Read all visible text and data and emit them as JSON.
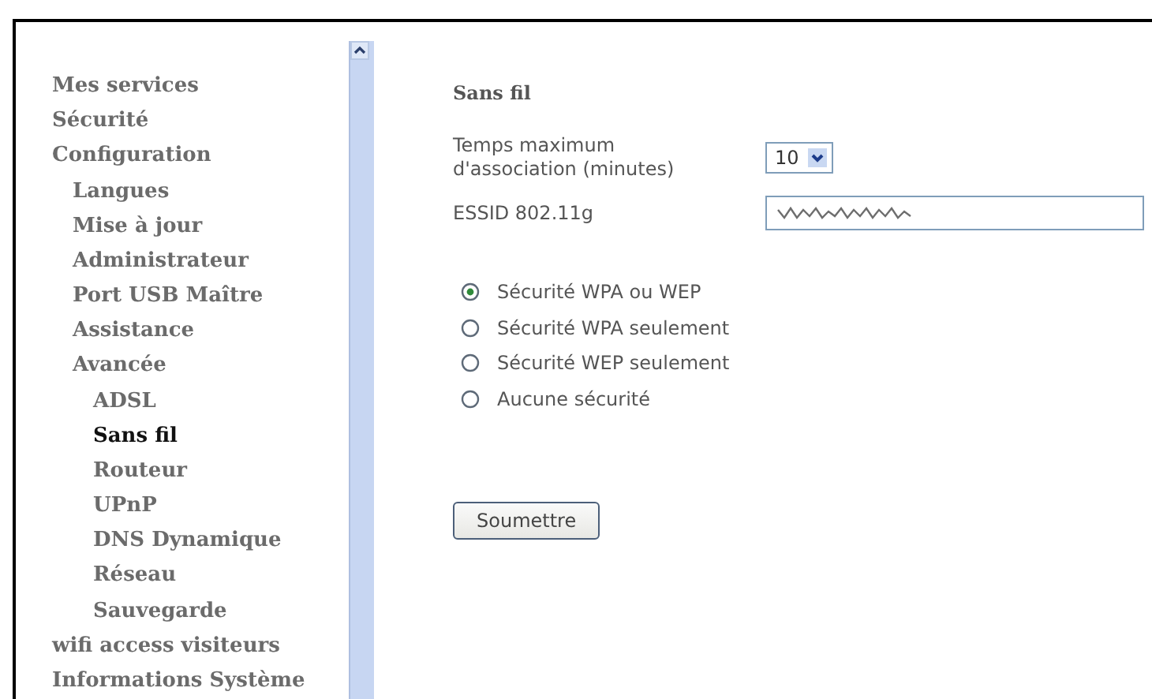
{
  "sidebar": {
    "items": [
      {
        "label": "Mes services",
        "selected": false
      },
      {
        "label": "Sécurité",
        "selected": false
      },
      {
        "label": "Configuration",
        "selected": false,
        "children": [
          {
            "label": "Langues",
            "selected": false
          },
          {
            "label": "Mise à jour",
            "selected": false
          },
          {
            "label": "Administrateur",
            "selected": false
          },
          {
            "label": "Port USB Maître",
            "selected": false
          },
          {
            "label": "Assistance",
            "selected": false
          },
          {
            "label": "Avancée",
            "selected": false,
            "children": [
              {
                "label": "ADSL",
                "selected": false
              },
              {
                "label": "Sans fil",
                "selected": true
              },
              {
                "label": "Routeur",
                "selected": false
              },
              {
                "label": "UPnP",
                "selected": false
              },
              {
                "label": "DNS Dynamique",
                "selected": false
              },
              {
                "label": "Réseau",
                "selected": false
              },
              {
                "label": "Sauvegarde",
                "selected": false
              }
            ]
          }
        ]
      },
      {
        "label": "wifi access visiteurs",
        "selected": false
      },
      {
        "label": "Informations Système",
        "selected": false
      }
    ]
  },
  "content": {
    "title": "Sans fil",
    "fields": [
      {
        "kind": "select",
        "label": "Temps maximum d'association (minutes)",
        "value": "10"
      },
      {
        "kind": "text",
        "label": "ESSID 802.11g",
        "redacted": true
      }
    ],
    "security_options": [
      {
        "label": "Sécurité WPA ou WEP",
        "selected": true
      },
      {
        "label": "Sécurité WPA seulement",
        "selected": false
      },
      {
        "label": "Sécurité WEP seulement",
        "selected": false
      },
      {
        "label": "Aucune sécurité",
        "selected": false
      }
    ],
    "submit_button": "Soumettre"
  }
}
